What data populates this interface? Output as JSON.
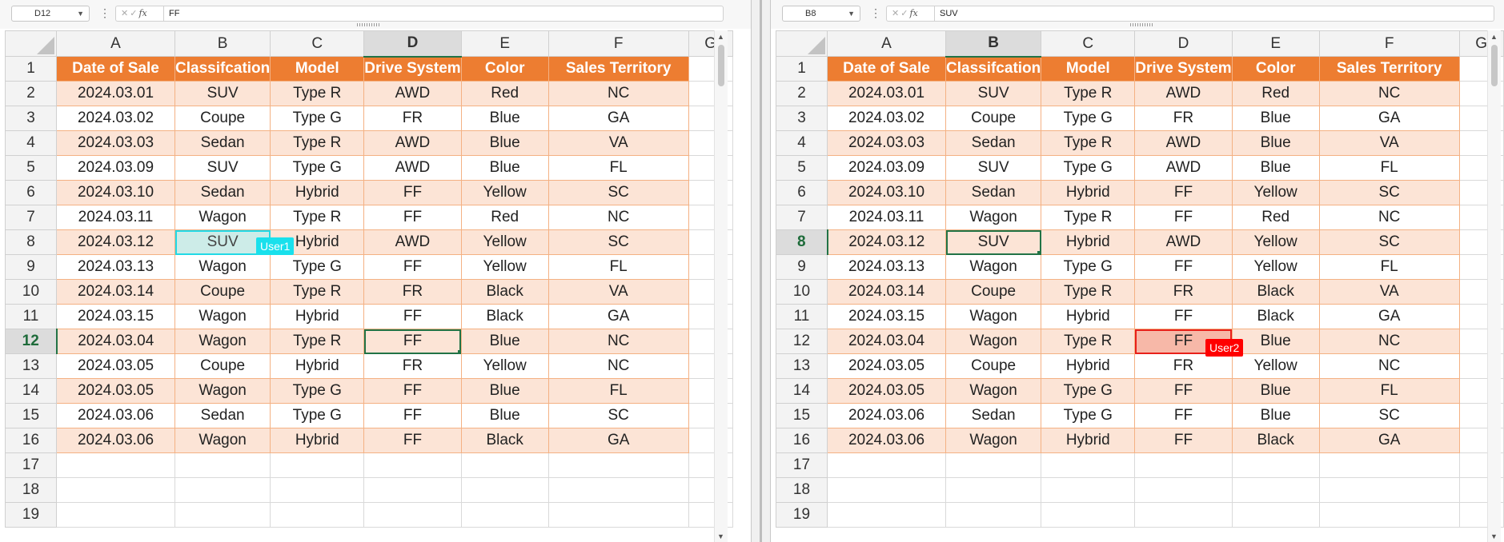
{
  "columns": [
    "A",
    "B",
    "C",
    "D",
    "E",
    "F",
    "G"
  ],
  "header": [
    "Date of Sale",
    "Classifcation",
    "Model",
    "Drive System",
    "Color",
    "Sales Territory"
  ],
  "rows": [
    [
      "2024.03.01",
      "SUV",
      "Type R",
      "AWD",
      "Red",
      "NC"
    ],
    [
      "2024.03.02",
      "Coupe",
      "Type G",
      "FR",
      "Blue",
      "GA"
    ],
    [
      "2024.03.03",
      "Sedan",
      "Type R",
      "AWD",
      "Blue",
      "VA"
    ],
    [
      "2024.03.09",
      "SUV",
      "Type G",
      "AWD",
      "Blue",
      "FL"
    ],
    [
      "2024.03.10",
      "Sedan",
      "Hybrid",
      "FF",
      "Yellow",
      "SC"
    ],
    [
      "2024.03.11",
      "Wagon",
      "Type R",
      "FF",
      "Red",
      "NC"
    ],
    [
      "2024.03.12",
      "SUV",
      "Hybrid",
      "AWD",
      "Yellow",
      "SC"
    ],
    [
      "2024.03.13",
      "Wagon",
      "Type G",
      "FF",
      "Yellow",
      "FL"
    ],
    [
      "2024.03.14",
      "Coupe",
      "Type R",
      "FR",
      "Black",
      "VA"
    ],
    [
      "2024.03.15",
      "Wagon",
      "Hybrid",
      "FF",
      "Black",
      "GA"
    ],
    [
      "2024.03.04",
      "Wagon",
      "Type R",
      "FF",
      "Blue",
      "NC"
    ],
    [
      "2024.03.05",
      "Coupe",
      "Hybrid",
      "FR",
      "Yellow",
      "NC"
    ],
    [
      "2024.03.05",
      "Wagon",
      "Type G",
      "FF",
      "Blue",
      "FL"
    ],
    [
      "2024.03.06",
      "Sedan",
      "Type G",
      "FF",
      "Blue",
      "SC"
    ],
    [
      "2024.03.06",
      "Wagon",
      "Hybrid",
      "FF",
      "Black",
      "GA"
    ]
  ],
  "row_numbers": [
    "1",
    "2",
    "3",
    "4",
    "5",
    "6",
    "7",
    "8",
    "9",
    "10",
    "11",
    "12",
    "13",
    "14",
    "15",
    "16",
    "17",
    "18",
    "19"
  ],
  "left": {
    "name_box": "D12",
    "formula": "FF",
    "fx_label": "fx",
    "remote_user_tag": "User1",
    "cell_overlay": "SUV",
    "selected_col": "D",
    "selected_row": "12"
  },
  "right": {
    "name_box": "B8",
    "formula": "SUV",
    "fx_label": "fx",
    "remote_user_tag": "User2",
    "cell_overlay": "FF",
    "selected_col": "B",
    "selected_row": "8"
  },
  "colors": {
    "header_fill": "#ed7d31",
    "band_fill": "#fce4d6",
    "user1": "#19e0ec",
    "user2": "#ff0000",
    "selection": "#217346"
  }
}
